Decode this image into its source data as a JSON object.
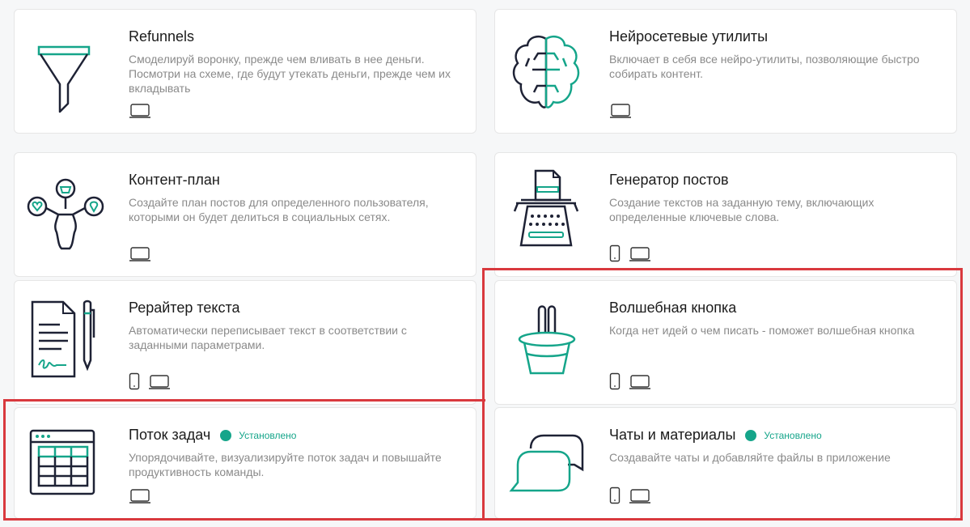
{
  "cards": [
    {
      "title": "Refunnels",
      "description": "Смоделируй воронку, прежде чем вливать в нее деньги. Посмотри на схеме, где будут утекать деньги, прежде чем их вкладывать",
      "icon": "funnel-icon",
      "devices": [
        "desktop"
      ]
    },
    {
      "title": "Нейросетевые утилиты",
      "description": "Включает в себя все нейро-утилиты, позволяющие быстро собирать контент.",
      "icon": "brain-icon",
      "devices": [
        "desktop"
      ]
    },
    {
      "title": "Контент-план",
      "description": "Создайте план постов для определенного пользователя, которыми он будет делиться в социальных сетях.",
      "icon": "content-plan-icon",
      "devices": [
        "desktop"
      ]
    },
    {
      "title": "Генератор постов",
      "description": "Создание текстов на заданную тему, включающих определенные ключевые слова.",
      "icon": "typewriter-icon",
      "devices": [
        "mobile",
        "desktop"
      ]
    },
    {
      "title": "Рерайтер текста",
      "description": "Автоматически переписывает текст в соответствии с заданными параметрами.",
      "icon": "document-pen-icon",
      "devices": [
        "mobile",
        "desktop"
      ]
    },
    {
      "title": "Волшебная кнопка",
      "description": "Когда нет идей о чем писать - поможет волшебная кнопка",
      "icon": "magic-hat-icon",
      "devices": [
        "mobile",
        "desktop"
      ]
    },
    {
      "title": "Поток задач",
      "status": "Установлено",
      "description": "Упорядочивайте, визуализируйте поток задач и повышайте продуктивность команды.",
      "icon": "task-board-icon",
      "devices": [
        "desktop"
      ]
    },
    {
      "title": "Чаты и материалы",
      "status": "Установлено",
      "description": "Создавайте чаты и добавляйте файлы в приложение",
      "icon": "chat-bubbles-icon",
      "devices": [
        "mobile",
        "desktop"
      ]
    }
  ],
  "colors": {
    "accent": "#15a58a",
    "ink": "#1e2235",
    "highlight": "#d9393e"
  }
}
